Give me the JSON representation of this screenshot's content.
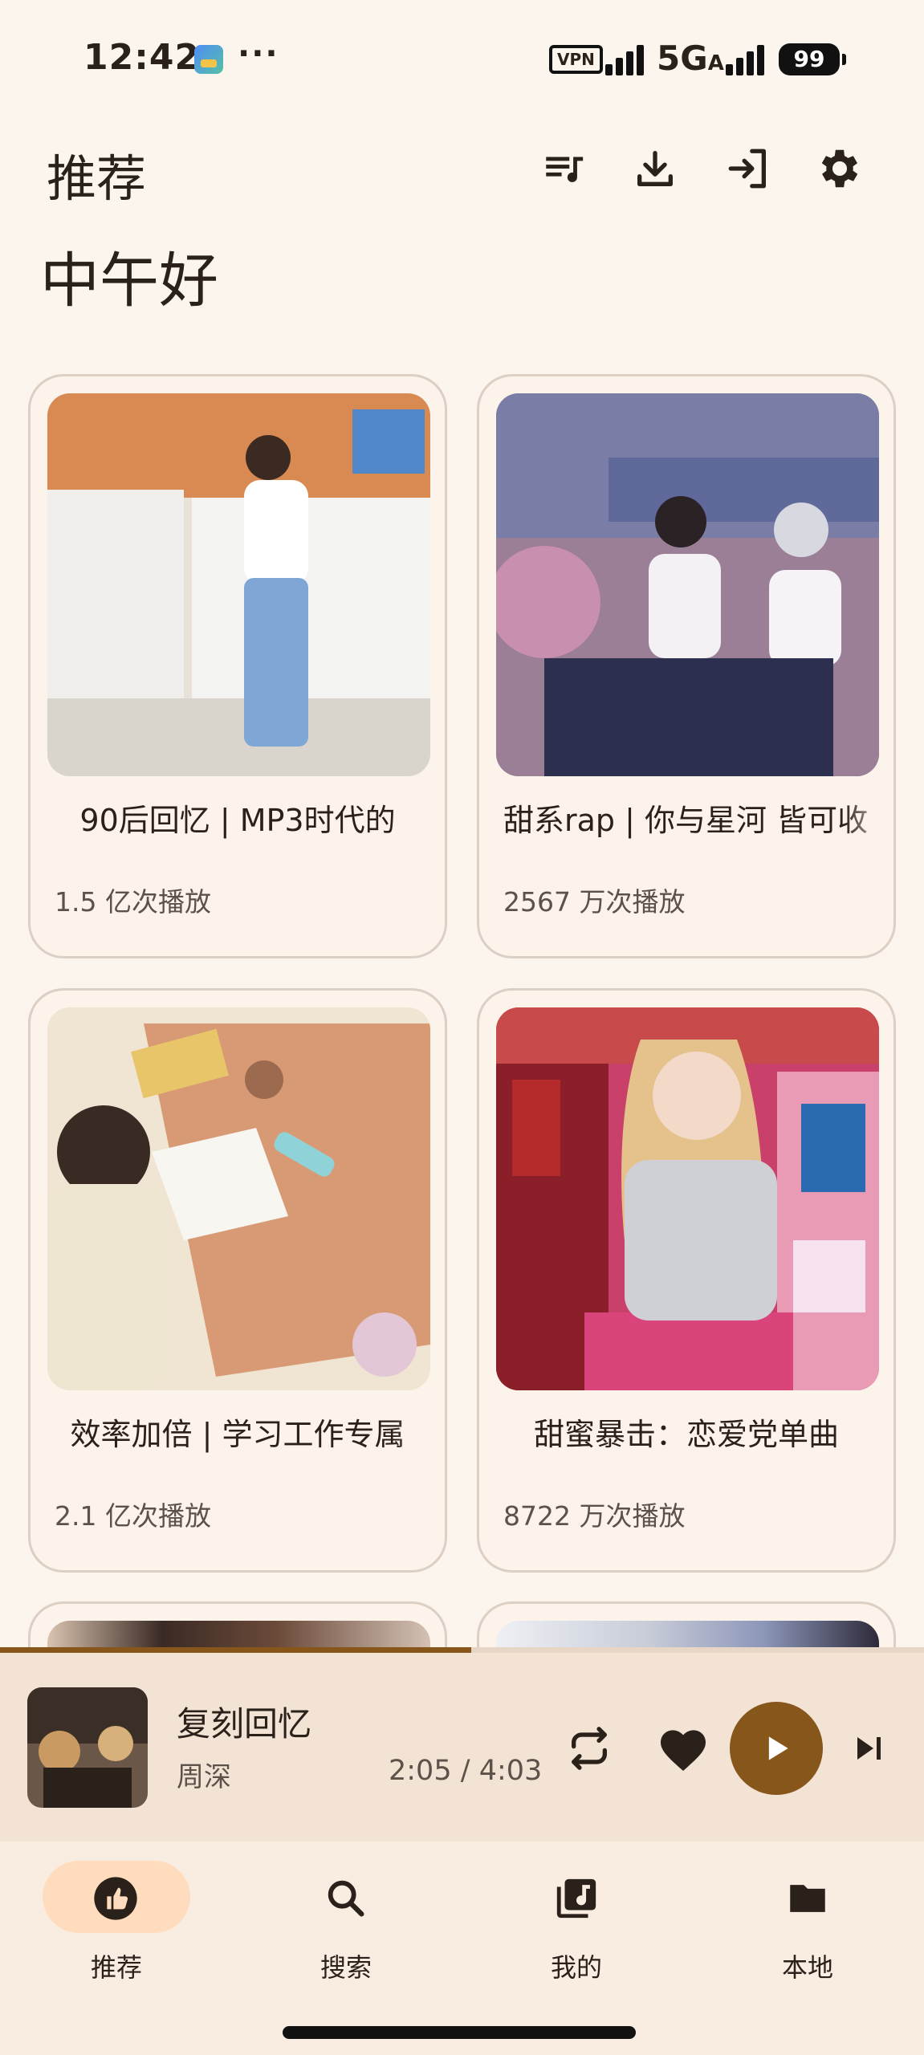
{
  "status_bar": {
    "time": "12:42",
    "more": "···",
    "vpn": "VPN",
    "network": "5G",
    "network_sub": "A",
    "battery": "99"
  },
  "header": {
    "title": "推荐",
    "greeting": "中午好",
    "icons": [
      "queue-music-icon",
      "download-icon",
      "login-icon",
      "gear-icon"
    ]
  },
  "playlists": [
    {
      "title": "90后回忆 | MP3时代的",
      "plays": "1.5 亿次播放"
    },
    {
      "title": "甜系rap | 你与星河 皆可收",
      "plays": "2567 万次播放"
    },
    {
      "title": "效率加倍 | 学习工作专属",
      "plays": "2.1 亿次播放"
    },
    {
      "title": "甜蜜暴击：恋爱党单曲",
      "plays": "8722 万次播放"
    }
  ],
  "player": {
    "song_title": "复刻回忆",
    "artist": "周深",
    "current_time": "2:05",
    "separator": "/",
    "total_time": "4:03",
    "progress": 0.51,
    "accent_color": "#86561a"
  },
  "bottom_nav": {
    "items": [
      {
        "label": "推荐",
        "icon": "thumb-up-icon",
        "active": true
      },
      {
        "label": "搜索",
        "icon": "search-icon",
        "active": false
      },
      {
        "label": "我的",
        "icon": "library-music-icon",
        "active": false
      },
      {
        "label": "本地",
        "icon": "folder-icon",
        "active": false
      }
    ]
  }
}
